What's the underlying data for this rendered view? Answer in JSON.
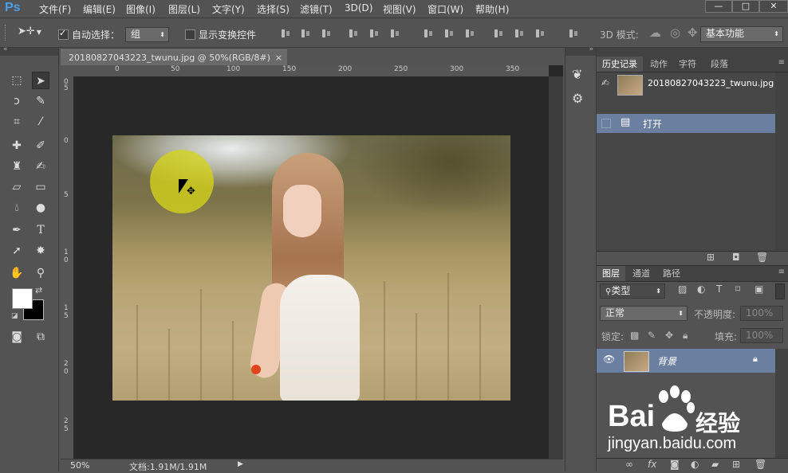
{
  "app": {
    "logo": "Ps"
  },
  "menu": [
    "文件(F)",
    "编辑(E)",
    "图像(I)",
    "图层(L)",
    "文字(Y)",
    "选择(S)",
    "滤镜(T)",
    "3D(D)",
    "视图(V)",
    "窗口(W)",
    "帮助(H)"
  ],
  "window_controls": {
    "minimize": "—",
    "maximize": "□",
    "close": "✕"
  },
  "options_bar": {
    "auto_select_label": "自动选择：",
    "auto_select_checked": true,
    "auto_select_value": "组",
    "show_transform_label": "显示变换控件",
    "show_transform_checked": false,
    "mode_3d_label": "3D 模式:",
    "workspace_value": "基本功能"
  },
  "document": {
    "tab_title": "20180827043223_twunu.jpg @ 50%(RGB/8#)",
    "tab_close": "×",
    "ruler_h_labels": [
      "0",
      "50",
      "100",
      "150",
      "200",
      "250",
      "300",
      "350"
    ],
    "ruler_v_labels": [
      "0",
      "5",
      "0",
      "5",
      "1",
      "0",
      "1",
      "5",
      "2",
      "0",
      "2",
      "5"
    ]
  },
  "status": {
    "zoom": "50%",
    "doc_info": "文档:1.91M/1.91M"
  },
  "history_panel": {
    "tabs": [
      "历史记录",
      "动作",
      "字符",
      "段落"
    ],
    "snapshot_name": "20180827043223_twunu.jpg",
    "items": [
      "打开"
    ]
  },
  "layers_panel": {
    "tabs": [
      "图层",
      "通道",
      "路径"
    ],
    "filter_type": "类型",
    "blend_mode": "正常",
    "opacity_label": "不透明度:",
    "opacity_value": "100%",
    "lock_label": "锁定:",
    "fill_label": "填充:",
    "fill_value": "100%",
    "layers": [
      {
        "name": "背景",
        "visible": true,
        "locked": true
      }
    ]
  },
  "watermark": {
    "brand": "Bai",
    "brand_suffix": "经验",
    "url": "jingyan.baidu.com"
  },
  "colors": {
    "brush_color": "#d4d418",
    "selection_blue": "#6b7fa0",
    "ps_blue": "#4a9fea"
  }
}
